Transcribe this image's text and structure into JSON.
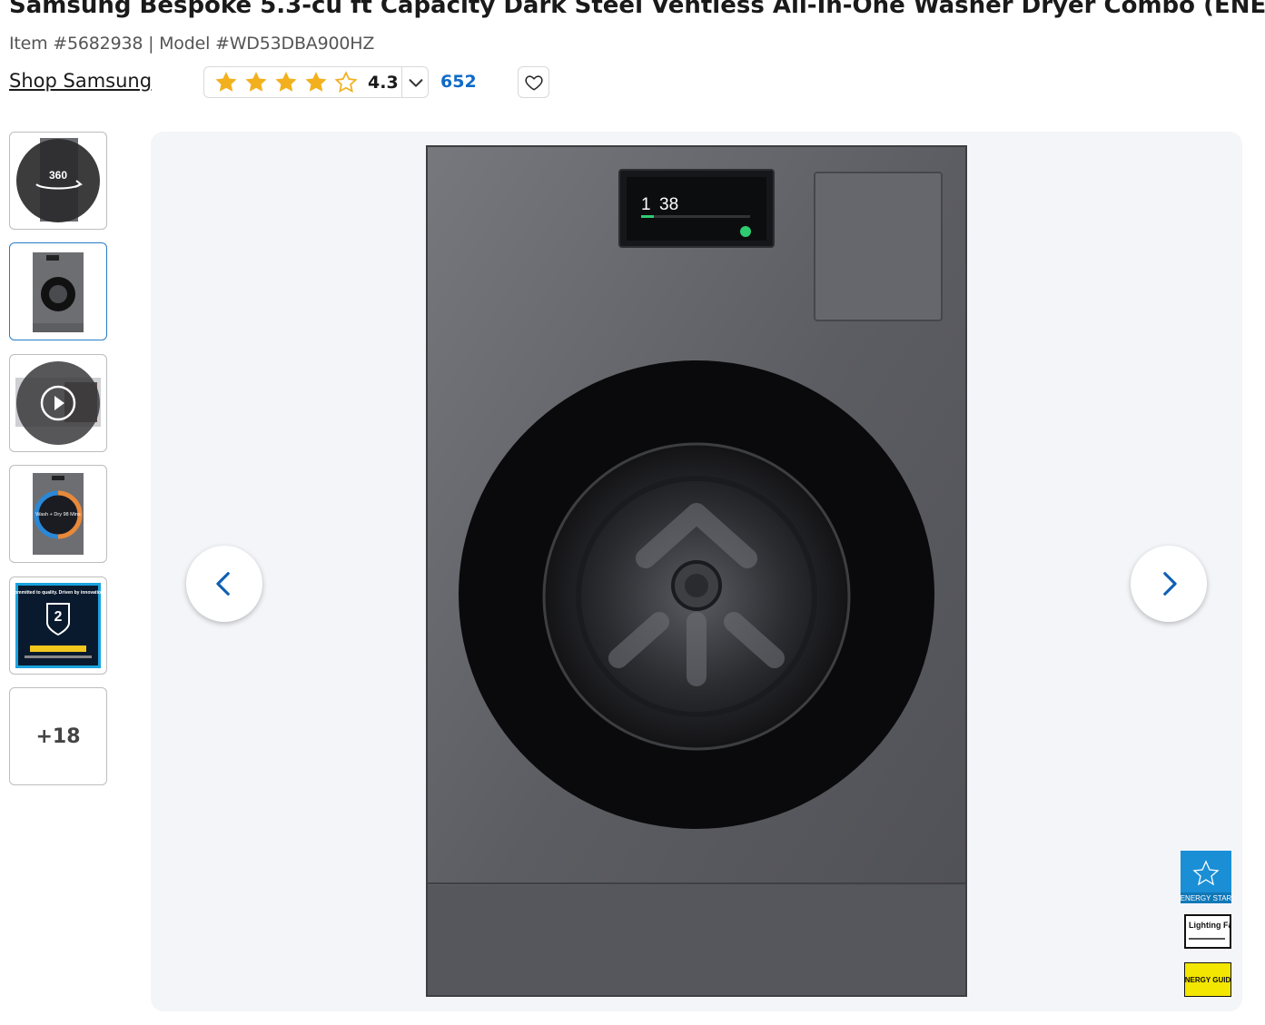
{
  "product": {
    "title": "Samsung Bespoke 5.3-cu ft Capacity Dark Steel Ventless All-In-One Washer Dryer Combo (ENERGY STAR)",
    "meta": "Item #5682938 | Model #WD53DBA900HZ",
    "brand_link": "Shop Samsung"
  },
  "rating": {
    "value": "4.3",
    "stars_filled": 4,
    "stars_total": 5,
    "review_count": "652"
  },
  "gallery": {
    "thumbnails": [
      {
        "label": "360",
        "kind": "360-view"
      },
      {
        "label": "",
        "kind": "image",
        "selected": true
      },
      {
        "label": "",
        "kind": "video"
      },
      {
        "label": "Wash + Dry 98 Mins",
        "kind": "image"
      },
      {
        "label": "Committed to quality. Driven by innovation.",
        "kind": "image",
        "badge": "2"
      },
      {
        "label": "+18",
        "kind": "more"
      }
    ],
    "screen": {
      "main": "1",
      "time": "38"
    }
  },
  "badges": {
    "energy_star": "ENERGY STAR",
    "lighting_facts": "Lighting Facts",
    "energy_guide": "ENERGY GUIDE"
  },
  "colors": {
    "star": "#f2b01e",
    "link": "#0e6bc8",
    "accent": "#2a7cc7",
    "appliance": "#5f6065"
  }
}
